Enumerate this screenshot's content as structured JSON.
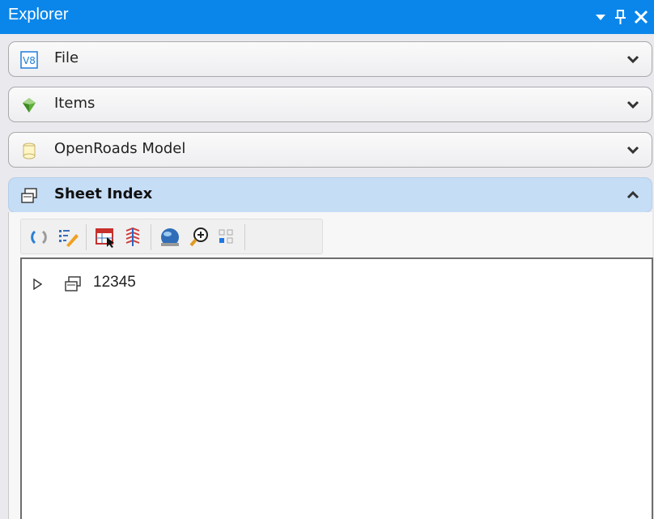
{
  "window": {
    "title": "Explorer",
    "accent_color": "#0a86ea"
  },
  "titlebar_buttons": [
    {
      "name": "menu-dropdown",
      "icon": "triangle-down-icon"
    },
    {
      "name": "pin",
      "icon": "pin-icon"
    },
    {
      "name": "close",
      "icon": "close-icon"
    }
  ],
  "sections": [
    {
      "label": "File",
      "icon": "v8-file-icon",
      "expanded": false
    },
    {
      "label": "Items",
      "icon": "items-gem-icon",
      "expanded": false
    },
    {
      "label": "OpenRoads Model",
      "icon": "openroads-model-icon",
      "expanded": false
    },
    {
      "label": "Sheet Index",
      "icon": "sheet-index-icon",
      "expanded": true
    }
  ],
  "toolbar": {
    "tools": [
      "refresh-icon",
      "edit-list-icon",
      "table-select-icon",
      "sheet-stack-icon",
      "globe-icon",
      "zoom-in-icon",
      "grid-select-icon"
    ]
  },
  "tree": {
    "nodes": [
      {
        "label": "12345",
        "icon": "sheet-index-icon",
        "expanded": false
      }
    ]
  }
}
